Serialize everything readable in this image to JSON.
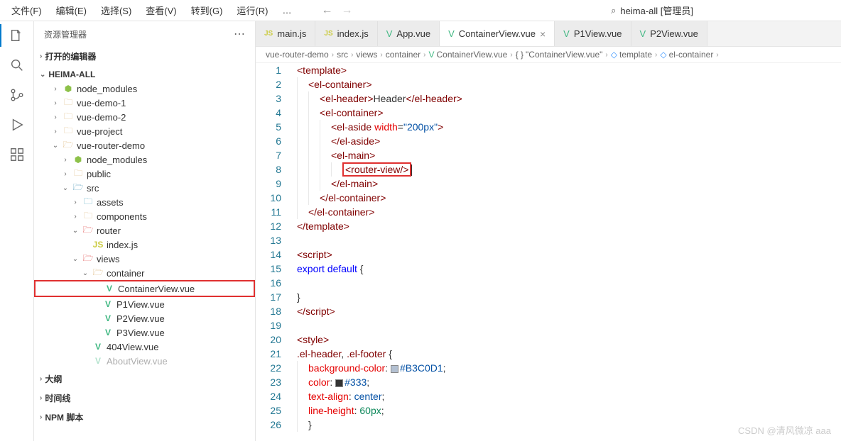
{
  "menubar": {
    "items": [
      "文件(F)",
      "编辑(E)",
      "选择(S)",
      "查看(V)",
      "转到(G)",
      "运行(R)",
      "…"
    ],
    "search_label": "heima-all [管理员]"
  },
  "sidebar": {
    "title": "资源管理器",
    "sections": {
      "open_editors": "打开的编辑器",
      "workspace": "HEIMA-ALL",
      "outline": "大纲",
      "timeline": "时间线",
      "npm": "NPM 脚本"
    },
    "tree": {
      "node_modules_top": "node_modules",
      "vue_demo_1": "vue-demo-1",
      "vue_demo_2": "vue-demo-2",
      "vue_project": "vue-project",
      "vue_router_demo": "vue-router-demo",
      "node_modules": "node_modules",
      "public": "public",
      "src": "src",
      "assets": "assets",
      "components": "components",
      "router": "router",
      "router_index": "index.js",
      "views": "views",
      "container": "container",
      "container_view": "ContainerView.vue",
      "p1view": "P1View.vue",
      "p2view": "P2View.vue",
      "p3view": "P3View.vue",
      "404view": "404View.vue",
      "aboutview": "AboutView.vue"
    }
  },
  "tabs": [
    {
      "icon": "js",
      "label": "main.js"
    },
    {
      "icon": "js",
      "label": "index.js"
    },
    {
      "icon": "vue",
      "label": "App.vue"
    },
    {
      "icon": "vue",
      "label": "ContainerView.vue",
      "active": true
    },
    {
      "icon": "vue",
      "label": "P1View.vue"
    },
    {
      "icon": "vue",
      "label": "P2View.vue"
    }
  ],
  "breadcrumb": [
    {
      "label": "vue-router-demo"
    },
    {
      "label": "src"
    },
    {
      "label": "views"
    },
    {
      "label": "container"
    },
    {
      "icon": "vue",
      "label": "ContainerView.vue"
    },
    {
      "icon": "brace",
      "label": "\"ContainerView.vue\""
    },
    {
      "icon": "tmpl",
      "label": "template"
    },
    {
      "icon": "tmpl",
      "label": "el-container"
    }
  ],
  "code": {
    "lines": 26,
    "l1": "<template>",
    "l2": "<el-container>",
    "l3_a": "<el-header>",
    "l3_b": "Header",
    "l3_c": "</el-header>",
    "l4": "<el-container>",
    "l5_a": "<el-aside",
    "l5_attr": "width",
    "l5_val": "\"200px\"",
    "l5_c": ">",
    "l6": "</el-aside>",
    "l7": "<el-main>",
    "l8": "<router-view/>",
    "l9": "</el-main>",
    "l10": "</el-container>",
    "l11": "</el-container>",
    "l12": "</template>",
    "l14": "<script>",
    "l15_a": "export",
    "l15_b": "default",
    "l15_c": " {",
    "l17": "}",
    "l18": "</script>",
    "l20": "<style>",
    "l21_a": ".el-header",
    "l21_b": ".el-footer",
    "l21_c": " {",
    "l22_p": "background-color",
    "l22_v": "#B3C0D1",
    "l23_p": "color",
    "l23_v": "#333",
    "l24_p": "text-align",
    "l24_v": "center",
    "l25_p": "line-height",
    "l25_v": "60px",
    "l26": "}"
  },
  "watermark": "CSDN @清风微凉 aaa"
}
